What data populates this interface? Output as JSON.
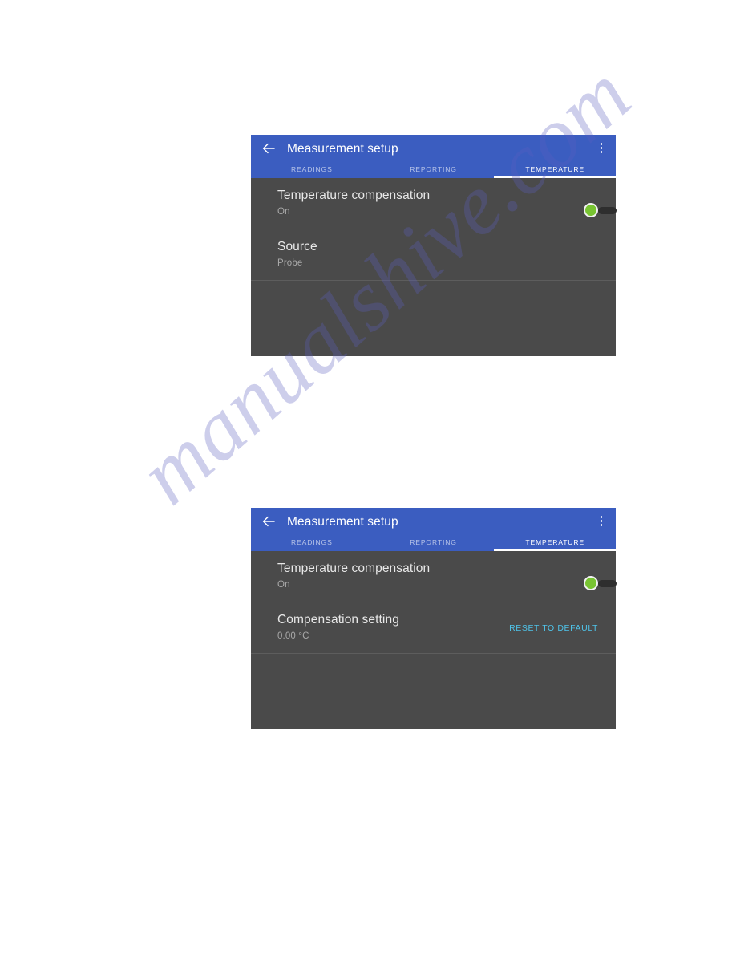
{
  "watermark": {
    "text": "manualshive.com",
    "color": "#5b5fc0"
  },
  "theme": {
    "appbar_blue": "#3b5dc0",
    "content_gray": "#4a4a4a",
    "divider": "#5d5d5d",
    "toggle_green": "#78c432",
    "link_blue": "#4fc3e8"
  },
  "screens": [
    {
      "appbar": {
        "back_icon": "arrow-left-icon",
        "title": "Measurement setup",
        "menu_icon": "more-vertical-icon"
      },
      "tabs": [
        {
          "label": "READINGS",
          "active": false
        },
        {
          "label": "REPORTING",
          "active": false
        },
        {
          "label": "TEMPERATURE",
          "active": true
        }
      ],
      "rows": [
        {
          "title": "Temperature compensation",
          "subtitle": "On",
          "control": "toggle",
          "toggle_state": "on"
        },
        {
          "title": "Source",
          "subtitle": "Probe",
          "control": "none"
        }
      ]
    },
    {
      "appbar": {
        "back_icon": "arrow-left-icon",
        "title": "Measurement setup",
        "menu_icon": "more-vertical-icon"
      },
      "tabs": [
        {
          "label": "READINGS",
          "active": false
        },
        {
          "label": "REPORTING",
          "active": false
        },
        {
          "label": "TEMPERATURE",
          "active": true
        }
      ],
      "rows": [
        {
          "title": "Temperature compensation",
          "subtitle": "On",
          "control": "toggle",
          "toggle_state": "on"
        },
        {
          "title": "Compensation setting",
          "subtitle": "0.00 °C",
          "control": "link",
          "link_label": "RESET TO DEFAULT"
        }
      ]
    }
  ]
}
